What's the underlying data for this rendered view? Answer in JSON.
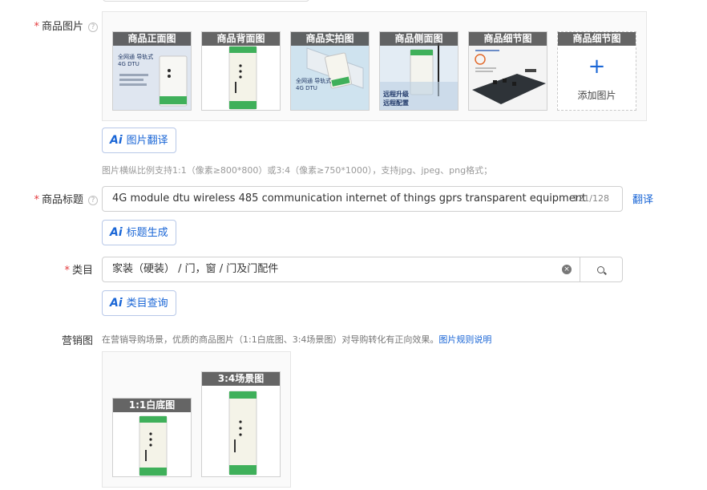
{
  "form": {
    "product_images": {
      "label": "商品图片",
      "required_mark": "*",
      "help": "?",
      "thumbnails": [
        {
          "caption": "商品正面图",
          "overlay": [
            "全网通 导轨式",
            "4G DTU"
          ]
        },
        {
          "caption": "商品背面图"
        },
        {
          "caption": "商品实拍图",
          "overlay": [
            "全网通 导轨式",
            "4G DTU"
          ]
        },
        {
          "caption": "商品侧面图",
          "overlay": [
            "远程升级",
            "远程配置"
          ]
        },
        {
          "caption": "商品细节图"
        }
      ],
      "add_slot": {
        "caption": "商品细节图",
        "plus": "+",
        "label": "添加图片"
      },
      "ai_button": {
        "logo": "Ai",
        "label": "图片翻译"
      },
      "hint": "图片横纵比例支持1:1（像素≥800*800）或3:4（像素≥750*1000），支持jpg、jpeg、png格式；"
    },
    "product_title": {
      "label": "商品标题",
      "required_mark": "*",
      "help": "?",
      "value": "4G module dtu wireless 485 communication internet of things gprs transparent  equipment",
      "counter": "121/128",
      "translate_link": "翻译",
      "ai_button": {
        "logo": "Ai",
        "label": "标题生成"
      }
    },
    "category": {
      "label": "类目",
      "required_mark": "*",
      "value": "家装（硬装） / 门，窗 / 门及门配件",
      "clear": "×",
      "ai_button": {
        "logo": "Ai",
        "label": "类目查询"
      }
    },
    "marketing": {
      "label": "营销图",
      "hint": "在营销导购场景，优质的商品图片（1:1白底图、3:4场景图）对导购转化有正向效果。",
      "hint_link": "图片规则说明",
      "images": [
        {
          "caption": "1:1白底图"
        },
        {
          "caption": "3:4场景图"
        }
      ]
    }
  },
  "colors": {
    "accent": "#1a66d6",
    "required": "#e4393c",
    "caption_bg": "#505050",
    "device_green": "#3fb05a"
  }
}
